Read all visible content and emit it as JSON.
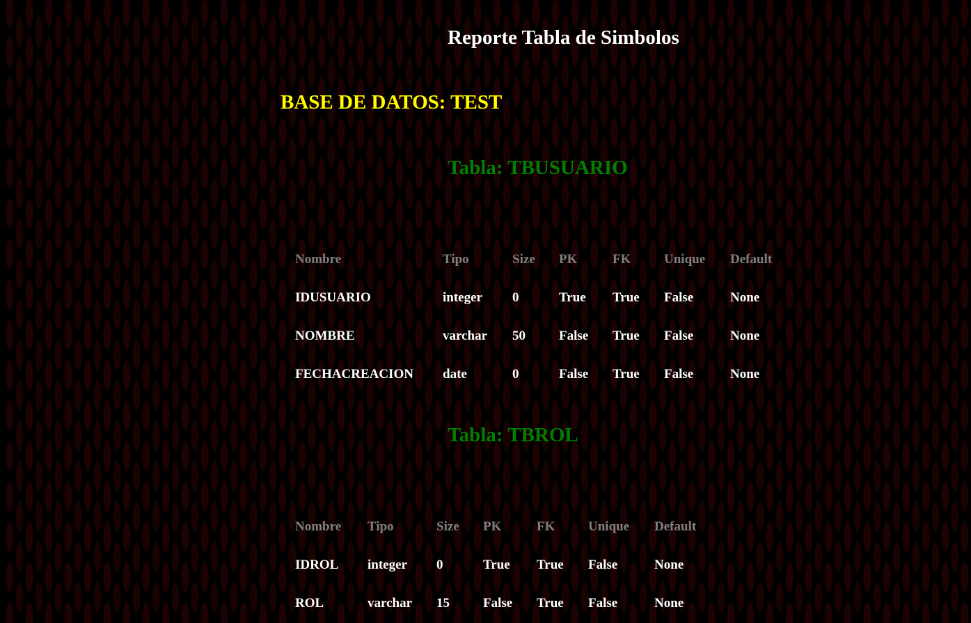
{
  "report": {
    "title": "Reporte Tabla de Simbolos",
    "database_label": "BASE DE DATOS: TEST"
  },
  "columns": [
    "Nombre",
    "Tipo",
    "Size",
    "PK",
    "FK",
    "Unique",
    "Default"
  ],
  "tables": [
    {
      "title": "Tabla: TBUSUARIO",
      "rows": [
        [
          "IDUSUARIO",
          "integer",
          "0",
          "True",
          "True",
          "False",
          "None"
        ],
        [
          "NOMBRE",
          "varchar",
          "50",
          "False",
          "True",
          "False",
          "None"
        ],
        [
          "FECHACREACION",
          "date",
          "0",
          "False",
          "True",
          "False",
          "None"
        ]
      ]
    },
    {
      "title": "Tabla: TBROL",
      "rows": [
        [
          "IDROL",
          "integer",
          "0",
          "True",
          "True",
          "False",
          "None"
        ],
        [
          "ROL",
          "varchar",
          "15",
          "False",
          "True",
          "False",
          "None"
        ]
      ]
    }
  ],
  "colors": {
    "background": "#000000",
    "pattern": "#1c0202",
    "title": "#ffffff",
    "database": "#ffff00",
    "table_title": "#008000",
    "header": "#808080",
    "cell": "#ffffff"
  }
}
